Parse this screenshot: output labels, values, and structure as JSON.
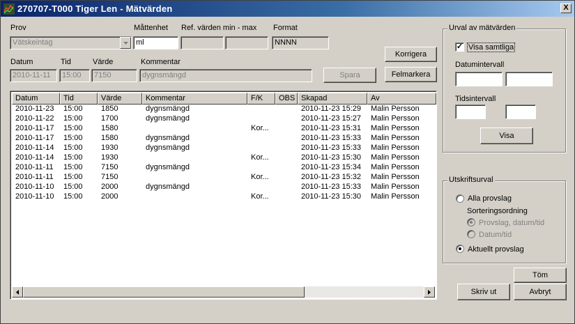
{
  "window": {
    "title": "270707-T000 Tiger Len  - Mätvärden",
    "close_label": "X"
  },
  "form": {
    "prov_label": "Prov",
    "prov_value": "Vätskeintag",
    "mattenhet_label": "Måttenhet",
    "mattenhet_value": "ml",
    "ref_label": "Ref. värden min - max",
    "ref_min": "",
    "ref_max": "",
    "format_label": "Format",
    "format_value": "NNNN",
    "datum_label": "Datum",
    "datum_value": "2010-11-11",
    "tid_label": "Tid",
    "tid_value": "15:00",
    "varde_label": "Värde",
    "varde_value": "7150",
    "kommentar_label": "Kommentar",
    "kommentar_value": "dygnsmängd"
  },
  "buttons": {
    "korrigera": "Korrigera",
    "spara": "Spara",
    "felmarkera": "Felmarkera",
    "visa": "Visa",
    "tom": "Töm",
    "skriv_ut": "Skriv ut",
    "avbryt": "Avbryt"
  },
  "table": {
    "columns": [
      "Datum",
      "Tid",
      "Värde",
      "Kommentar",
      "F/K",
      "OBS",
      "Skapad",
      "Av"
    ],
    "rows": [
      [
        "2010-11-23",
        "15:00",
        "1850",
        "dygnsmängd",
        "",
        "",
        "2010-11-23 15:29",
        "Malin Persson"
      ],
      [
        "2010-11-22",
        "15:00",
        "1700",
        "dygnsmängd",
        "",
        "",
        "2010-11-23 15:27",
        "Malin Persson"
      ],
      [
        "2010-11-17",
        "15:00",
        "1580",
        "",
        "Kor...",
        "",
        "2010-11-23 15:31",
        "Malin Persson"
      ],
      [
        "2010-11-17",
        "15:00",
        "1580",
        "dygnsmängd",
        "",
        "",
        "2010-11-23 15:33",
        "Malin Persson"
      ],
      [
        "2010-11-14",
        "15:00",
        "1930",
        "dygnsmängd",
        "",
        "",
        "2010-11-23 15:33",
        "Malin Persson"
      ],
      [
        "2010-11-14",
        "15:00",
        "1930",
        "",
        "Kor...",
        "",
        "2010-11-23 15:30",
        "Malin Persson"
      ],
      [
        "2010-11-11",
        "15:00",
        "7150",
        "dygnsmängd",
        "",
        "",
        "2010-11-23 15:34",
        "Malin Persson"
      ],
      [
        "2010-11-11",
        "15:00",
        "7150",
        "",
        "Kor...",
        "",
        "2010-11-23 15:32",
        "Malin Persson"
      ],
      [
        "2010-11-10",
        "15:00",
        "2000",
        "dygnsmängd",
        "",
        "",
        "2010-11-23 15:33",
        "Malin Persson"
      ],
      [
        "2010-11-10",
        "15:00",
        "2000",
        "",
        "Kor...",
        "",
        "2010-11-23 15:30",
        "Malin Persson"
      ]
    ]
  },
  "urval": {
    "title": "Urval av mätvärden",
    "visa_samtliga_label": "Visa samtliga",
    "visa_samtliga_checked": true,
    "datumintervall_label": "Datumintervall",
    "tidsintervall_label": "Tidsintervall"
  },
  "utskrift": {
    "title": "Utskriftsurval",
    "alla_provslag": "Alla provslag",
    "sortering_label": "Sorteringsordning",
    "sort_provslag": "Provslag, datum/tid",
    "sort_datum": "Datum/tid",
    "aktuellt_provslag": "Aktuellt provslag",
    "selected": "aktuellt"
  }
}
